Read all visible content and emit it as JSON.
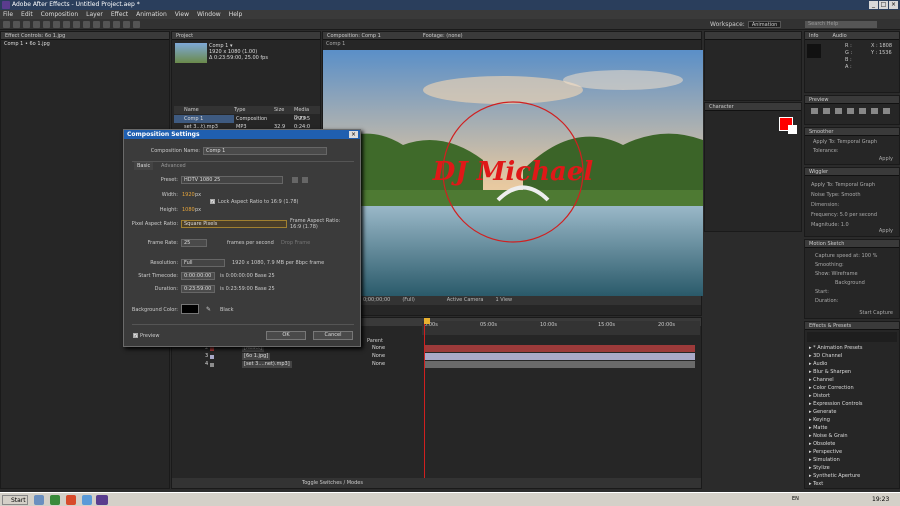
{
  "app": {
    "title": "Adobe After Effects - Untitled Project.aep *"
  },
  "menu": [
    "File",
    "Edit",
    "Composition",
    "Layer",
    "Effect",
    "Animation",
    "View",
    "Window",
    "Help"
  ],
  "toolbar": {
    "workspace_label": "Workspace:",
    "workspace_value": "Animation",
    "search_placeholder": "Search Help"
  },
  "effect_controls": {
    "tab": "Effect Controls: 6o 1.jpg",
    "item": "Comp 1 • 6o 1.jpg"
  },
  "project": {
    "tab": "Project",
    "comp_name": "Comp 1 ▾",
    "comp_size": "1920 x 1080 (1.00)",
    "comp_duration": "Δ 0:23:59:00, 25.00 fps",
    "columns": [
      "Name",
      "Type",
      "Size",
      "Media Dura"
    ],
    "rows": [
      {
        "name": "Comp 1",
        "type": "Composition",
        "size": "",
        "duration": "0:23:5"
      },
      {
        "name": "set 3...t).mp3",
        "type": "MP3",
        "size": "32.9 MB",
        "duration": "0:24:0"
      }
    ]
  },
  "composition_viewer": {
    "tab": "Composition: Comp 1",
    "subtab": "Comp 1",
    "footage_tab": "Footage: (none)",
    "overlay_text": "DJ Michael",
    "zoom": "(Full)",
    "camera": "Active Camera",
    "view": "1 View",
    "timecode": "0;00;00;00"
  },
  "dialog": {
    "title": "Composition Settings",
    "comp_name_label": "Composition Name:",
    "comp_name_value": "Comp 1",
    "tab_basic": "Basic",
    "tab_advanced": "Advanced",
    "preset_label": "Preset:",
    "preset_value": "HDTV 1080 25",
    "width_label": "Width:",
    "width_value": "1920",
    "height_label": "Height:",
    "height_value": "1080",
    "px": "px",
    "lock_label": "Lock Aspect Ratio to 16:9 (1.78)",
    "par_label": "Pixel Aspect Ratio:",
    "par_value": "Square Pixels",
    "frame_aspect_label": "Frame Aspect Ratio:",
    "frame_aspect_value": "16:9 (1.78)",
    "frame_rate_label": "Frame Rate:",
    "frame_rate_value": "25",
    "fps_unit": "frames per second",
    "drop_frame": "Drop Frame",
    "resolution_label": "Resolution:",
    "resolution_value": "Full",
    "resolution_info": "1920 x 1080, 7.9 MB per 8bpc frame",
    "start_tc_label": "Start Timecode:",
    "start_tc_value": "0:00:00:00",
    "start_tc_info": "is 0:00:00:00  Base 25",
    "duration_label": "Duration:",
    "duration_value": "0:23:59:00",
    "duration_info": "is 0:23:59:00  Base 25",
    "bg_label": "Background Color:",
    "bg_name": "Black",
    "preview_label": "Preview",
    "ok_label": "OK",
    "cancel_label": "Cancel"
  },
  "timeline": {
    "ruler": [
      "0:00s",
      "05:00s",
      "10:00s",
      "15:00s",
      "20:00s"
    ],
    "parent_label": "Parent",
    "layers": [
      {
        "num": "2",
        "name": "[React]",
        "parent": "None",
        "color": "#b23c3c"
      },
      {
        "num": "3",
        "name": "[6o 1.jpg]",
        "parent": "None",
        "color": "#a9a9c8"
      },
      {
        "num": "4",
        "name": "[set 3....net).mp3]",
        "parent": "None",
        "color": "#8c8c8c"
      }
    ],
    "toggle_label": "Toggle Switches / Modes"
  },
  "info": {
    "tab_info": "Info",
    "tab_audio": "Audio",
    "r": "R :",
    "g": "G :",
    "b": "B :",
    "a": "A :",
    "x": "X : 1808",
    "y": "Y : 1536"
  },
  "preview": {
    "tab": "Preview"
  },
  "paragraph": {
    "tab": "Character"
  },
  "wiggler": {
    "tab": "Wiggler",
    "apply_to": "Apply To:",
    "apply_val": "Temporal Graph",
    "noise": "Noise Type:",
    "noise_val": "Smooth",
    "dimension": "Dimension:",
    "frequency": "Frequency:",
    "freq_val": "5.0 per second",
    "magnitude": "Magnitude:",
    "mag_val": "1.0",
    "apply_btn": "Apply"
  },
  "motion_sketch": {
    "tab": "Motion Sketch",
    "capture_speed": "Capture speed at: 100 %",
    "smoothing": "Smoothing:",
    "show": "Show:",
    "wireframe": "Wireframe",
    "background": "Background",
    "start": "Start:",
    "duration": "Duration:",
    "capture_btn": "Start Capture"
  },
  "smoother": {
    "tab": "Smoother",
    "apply_to": "Apply To:",
    "apply_val": "Temporal Graph",
    "tolerance": "Tolerance:",
    "apply_btn": "Apply"
  },
  "effects_presets": {
    "tab": "Effects & Presets",
    "items": [
      "* Animation Presets",
      "3D Channel",
      "Audio",
      "Blur & Sharpen",
      "Channel",
      "Color Correction",
      "Distort",
      "Expression Controls",
      "Generate",
      "Keying",
      "Matte",
      "Noise & Grain",
      "Obsolete",
      "Perspective",
      "Simulation",
      "Stylize",
      "Synthetic Aperture",
      "Text"
    ]
  },
  "taskbar": {
    "start": "Start",
    "clock": "19:23",
    "lang": "EN"
  }
}
